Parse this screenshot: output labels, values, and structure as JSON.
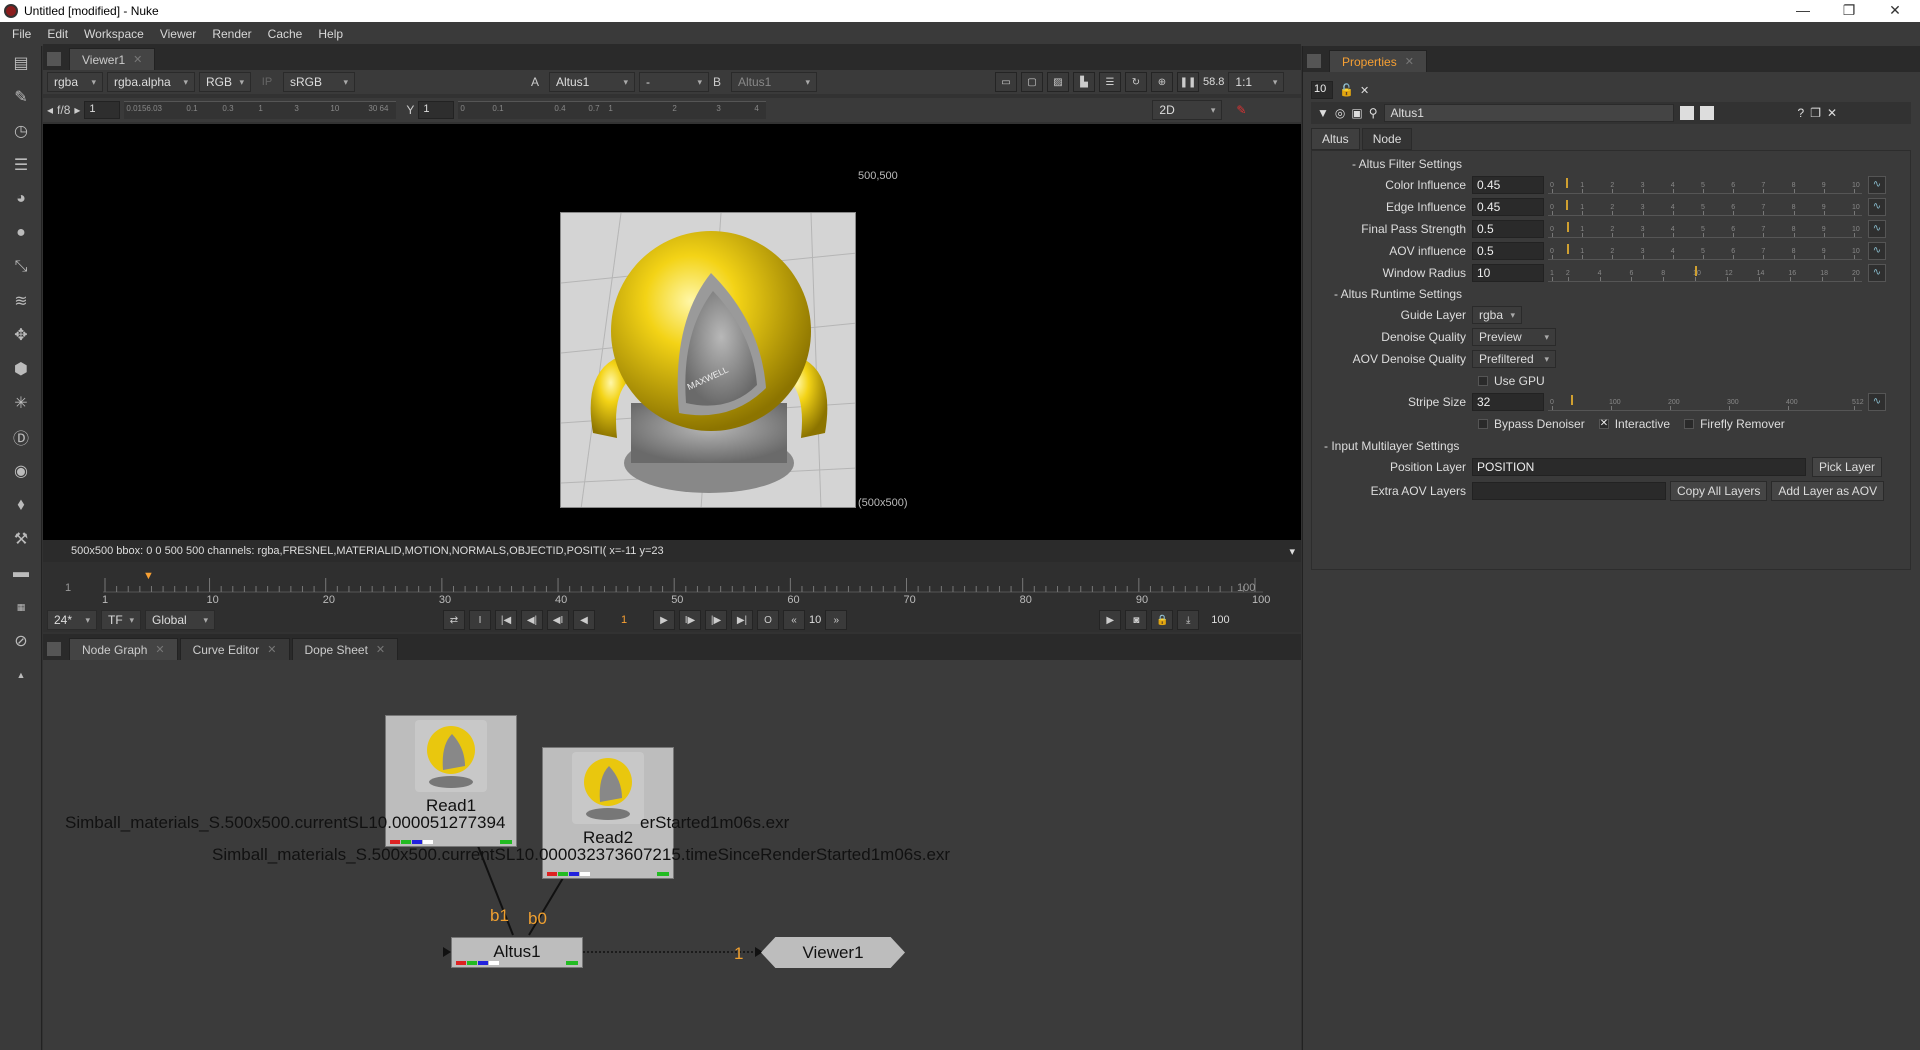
{
  "window": {
    "title": "Untitled [modified] - Nuke",
    "minimize": "—",
    "maximize": "❐",
    "close": "✕"
  },
  "menu": [
    "File",
    "Edit",
    "Workspace",
    "Viewer",
    "Render",
    "Cache",
    "Help"
  ],
  "viewer": {
    "tab": "Viewer1",
    "channels": "rgba",
    "alpha_channel": "rgba.alpha",
    "display": "RGB",
    "ip": "IP",
    "lut": "sRGB",
    "input_a_label": "A",
    "input_a": "Altus1",
    "input_op": "-",
    "input_b_label": "B",
    "input_b": "Altus1",
    "zoom": "58.8",
    "ratio": "1:1",
    "fstop": "f/8",
    "gain": "1",
    "y_label": "Y",
    "gamma": "1",
    "mode": "2D",
    "corner_tr": "500,500",
    "corner_br": "(500x500)",
    "info": "500x500  bbox: 0 0 500 500 channels: rgba,FRESNEL,MATERIALID,MOTION,NORMALS,OBJECTID,POSITI(  x=-11 y=23",
    "gain_ticks": [
      "0.0156.03",
      "0.1",
      "0.3",
      "1",
      "3",
      "10",
      "30 64"
    ],
    "gamma_ticks": [
      "0",
      "0.1",
      "0.4",
      "0.7",
      "1",
      "2",
      "3",
      "4"
    ]
  },
  "timeline": {
    "start": "1",
    "end": "100",
    "current": "1",
    "ticks": [
      "1",
      "10",
      "20",
      "30",
      "40",
      "50",
      "60",
      "70",
      "80",
      "90",
      "100"
    ],
    "fps": "24*",
    "tf": "TF",
    "range": "Global",
    "step": "10",
    "out": "100"
  },
  "bottom_tabs": [
    {
      "label": "Node Graph"
    },
    {
      "label": "Curve Editor"
    },
    {
      "label": "Dope Sheet"
    }
  ],
  "nodes": {
    "read1": {
      "label": "Read1",
      "file": "Simball_materials_S.500x500.currentSL10.000051277394",
      "file_tail": "erStarted1m06s.exr"
    },
    "read2": {
      "label": "Read2",
      "file": "Simball_materials_S.500x500.currentSL10.000032373607215.timeSinceRenderStarted1m06s.exr"
    },
    "altus": {
      "label": "Altus1"
    },
    "viewer": {
      "label": "Viewer1"
    },
    "pipe_b1": "b1",
    "pipe_b0": "b0",
    "pipe_1": "1"
  },
  "properties": {
    "tab": "Properties",
    "max_panels": "10",
    "node_name": "Altus1",
    "tabs": [
      "Altus",
      "Node"
    ],
    "groups": {
      "filter": "- Altus Filter Settings",
      "runtime": "- Altus Runtime Settings",
      "multilayer": "- Input Multilayer Settings"
    },
    "knobs": {
      "color_influence": {
        "label": "Color Influence",
        "value": "0.45"
      },
      "edge_influence": {
        "label": "Edge Influence",
        "value": "0.45"
      },
      "final_pass": {
        "label": "Final Pass Strength",
        "value": "0.5"
      },
      "aov_influence": {
        "label": "AOV influence",
        "value": "0.5"
      },
      "window_radius": {
        "label": "Window Radius",
        "value": "10"
      },
      "guide_layer": {
        "label": "Guide Layer",
        "value": "rgba"
      },
      "denoise_quality": {
        "label": "Denoise Quality",
        "value": "Preview"
      },
      "aov_denoise_quality": {
        "label": "AOV Denoise Quality",
        "value": "Prefiltered"
      },
      "use_gpu": {
        "label": "Use GPU"
      },
      "stripe_size": {
        "label": "Stripe Size",
        "value": "32"
      },
      "bypass": {
        "label": "Bypass Denoiser"
      },
      "interactive": {
        "label": "Interactive"
      },
      "firefly": {
        "label": "Firefly Remover"
      },
      "position_layer": {
        "label": "Position Layer",
        "value": "POSITION"
      },
      "extra_aov": {
        "label": "Extra AOV Layers",
        "value": ""
      }
    },
    "buttons": {
      "pick_layer": "Pick Layer",
      "copy_all": "Copy All Layers",
      "add_layer": "Add Layer as AOV"
    },
    "slider_ticks_10": [
      "0",
      "1",
      "2",
      "3",
      "4",
      "5",
      "6",
      "7",
      "8",
      "9",
      "10"
    ],
    "slider_ticks_radius": [
      "1",
      "2",
      "4",
      "6",
      "8",
      "10",
      "12",
      "14",
      "16",
      "18",
      "20"
    ],
    "slider_ticks_stripe": [
      "0",
      "100",
      "200",
      "300",
      "400",
      "512"
    ]
  }
}
